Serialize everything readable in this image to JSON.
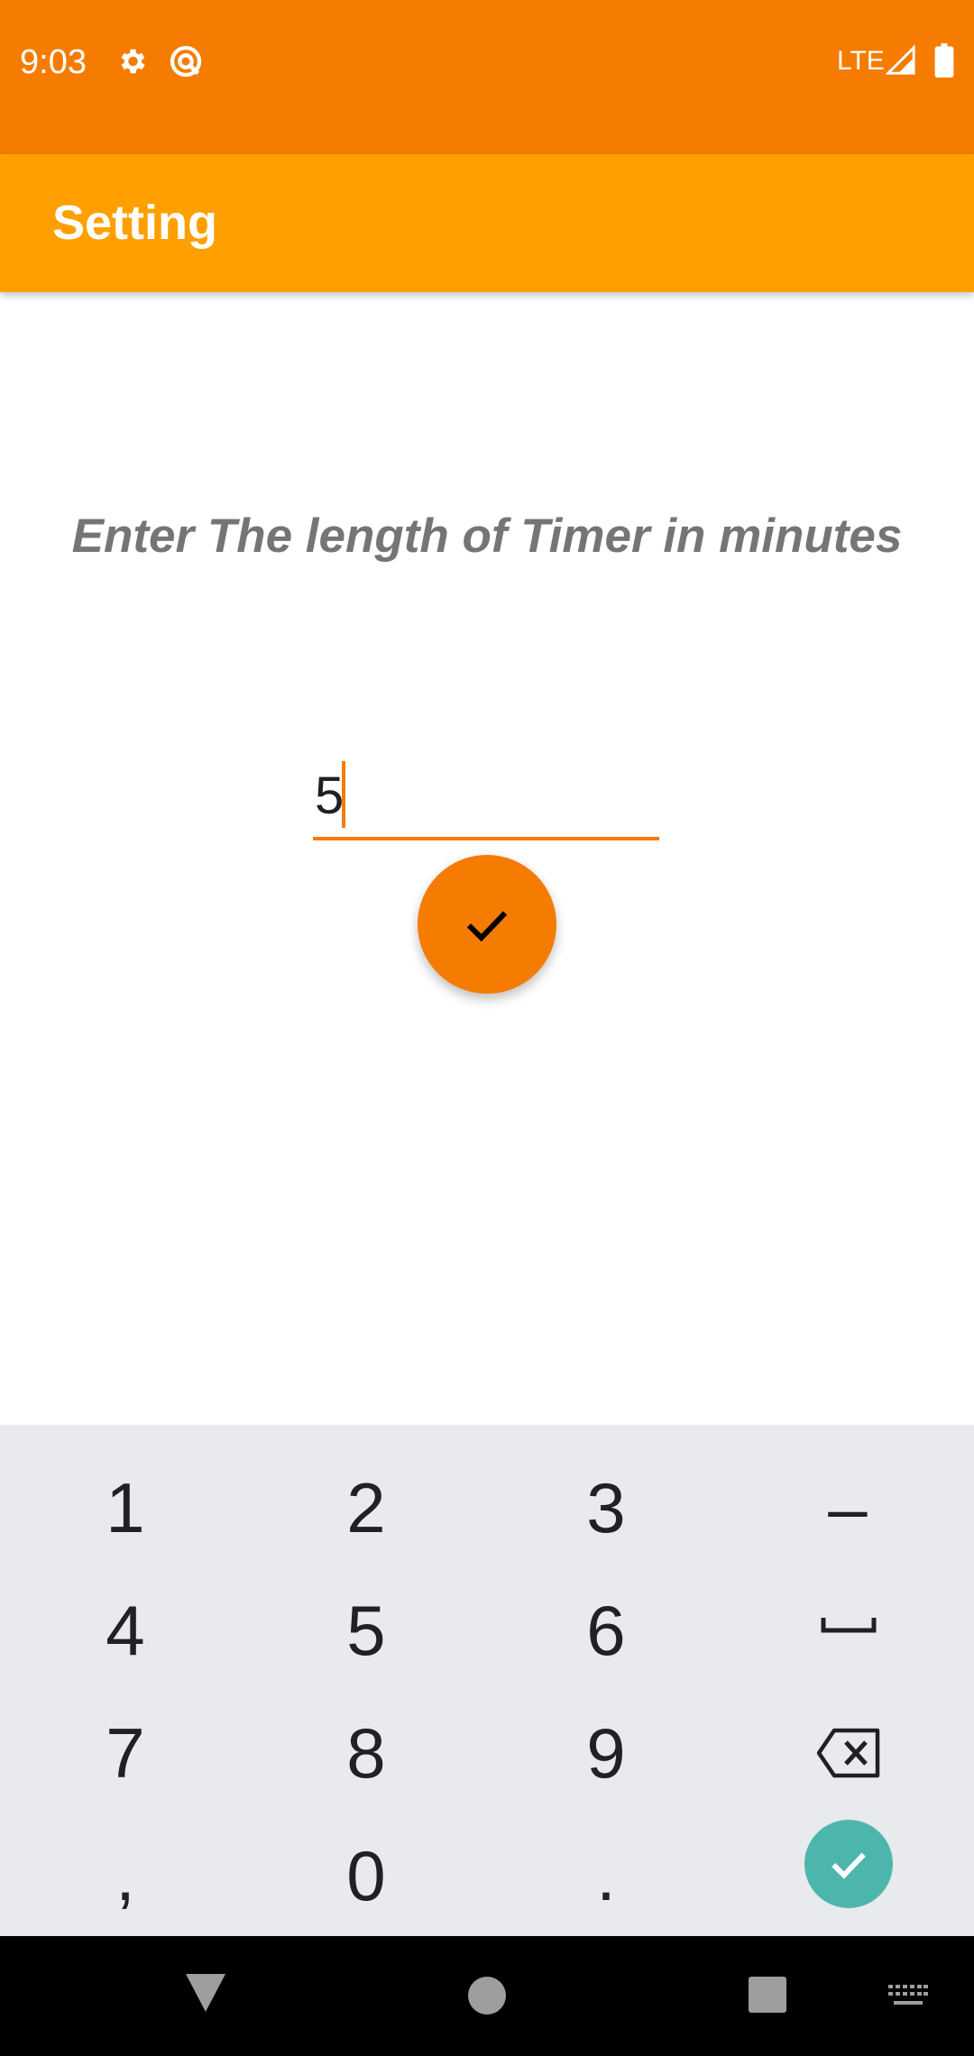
{
  "status_bar": {
    "time": "9:03",
    "network": "LTE",
    "icons": [
      "gear-icon",
      "sync-icon",
      "signal-icon",
      "battery-icon"
    ],
    "color": "#F57C00"
  },
  "app_bar": {
    "title": "Setting",
    "color": "#FFA000"
  },
  "main": {
    "prompt": "Enter The length of Timer in minutes",
    "input_value": "5",
    "submit_icon": "check-icon",
    "accent": "#F57C00"
  },
  "keyboard": {
    "keys": [
      "1",
      "2",
      "3",
      "–",
      "4",
      "5",
      "6",
      "space",
      "7",
      "8",
      "9",
      "backspace",
      ",",
      "0",
      "."
    ],
    "row1": [
      "1",
      "2",
      "3",
      "–"
    ],
    "row2": [
      "4",
      "5",
      "6"
    ],
    "row3": [
      "7",
      "8",
      "9"
    ],
    "row4": [
      ",",
      "0",
      "."
    ],
    "enter_color": "#4DB6AC"
  },
  "nav_bar": {
    "icons": [
      "back-icon",
      "home-icon",
      "recents-icon",
      "keyboard-switch-icon"
    ]
  }
}
